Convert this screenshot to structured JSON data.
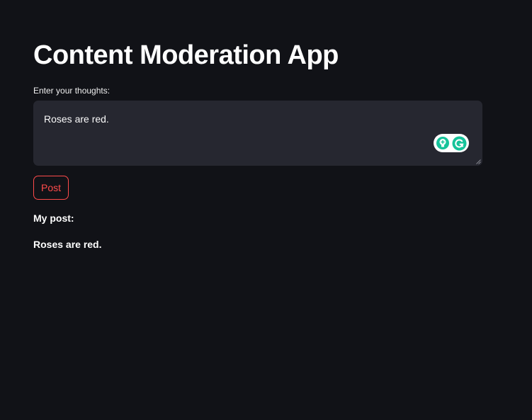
{
  "app": {
    "title": "Content Moderation App"
  },
  "input": {
    "label": "Enter your thoughts:",
    "value": "Roses are red."
  },
  "extension": {
    "icons": [
      "lightbulb-icon",
      "grammarly-icon"
    ],
    "colors": {
      "accent": "#15c39a"
    }
  },
  "actions": {
    "post_label": "Post"
  },
  "output": {
    "heading": "My post:",
    "content": "Roses are red."
  },
  "colors": {
    "background": "#111217",
    "field": "#262730",
    "primary": "#ff4b4b",
    "text": "#fafafa"
  }
}
